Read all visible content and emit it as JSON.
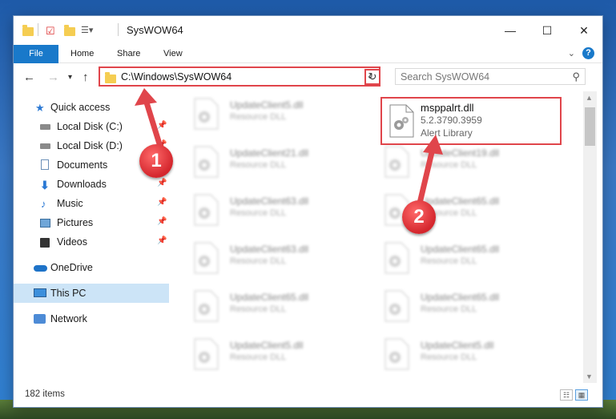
{
  "window": {
    "title": "SysWOW64"
  },
  "ribbon": {
    "tabs": [
      "File",
      "Home",
      "Share",
      "View"
    ],
    "help": "?"
  },
  "nav": {
    "address": "C:\\Windows\\SysWOW64",
    "search_placeholder": "Search SysWOW64"
  },
  "sidebar": {
    "items": [
      {
        "label": "Quick access",
        "icon": "star-icon"
      },
      {
        "label": "Local Disk (C:)",
        "icon": "drive-icon"
      },
      {
        "label": "Local Disk (D:)",
        "icon": "drive-icon"
      },
      {
        "label": "Documents",
        "icon": "document-icon"
      },
      {
        "label": "Downloads",
        "icon": "download-icon"
      },
      {
        "label": "Music",
        "icon": "music-icon"
      },
      {
        "label": "Pictures",
        "icon": "picture-icon"
      },
      {
        "label": "Videos",
        "icon": "video-icon"
      },
      {
        "label": "OneDrive",
        "icon": "cloud-icon"
      },
      {
        "label": "This PC",
        "icon": "pc-icon"
      },
      {
        "label": "Network",
        "icon": "network-icon"
      }
    ]
  },
  "files": [
    {
      "name": "UpdateClient5.dll",
      "type": "Resource DLL"
    },
    {
      "name": "UpdateClient21.dll",
      "type": "Resource DLL"
    },
    {
      "name": "UpdateClient19.dll",
      "type": "Resource DLL"
    },
    {
      "name": "UpdateClient63.dll",
      "type": "Resource DLL"
    },
    {
      "name": "UpdateClient65.dll",
      "type": "Resource DLL"
    },
    {
      "name": "UpdateClient63.dll",
      "type": "Resource DLL"
    },
    {
      "name": "UpdateClient65.dll",
      "type": "Resource DLL"
    },
    {
      "name": "UpdateClient65.dll",
      "type": "Resource DLL"
    },
    {
      "name": "UpdateClient65.dll",
      "type": "Resource DLL"
    },
    {
      "name": "UpdateClient5.dll",
      "type": "Resource DLL"
    },
    {
      "name": "UpdateClient5.dll",
      "type": "Resource DLL"
    }
  ],
  "highlighted_file": {
    "name": "msppalrt.dll",
    "version": "5.2.3790.3959",
    "description": "Alert Library"
  },
  "status": {
    "count": "182 items"
  },
  "callouts": [
    "1",
    "2"
  ]
}
